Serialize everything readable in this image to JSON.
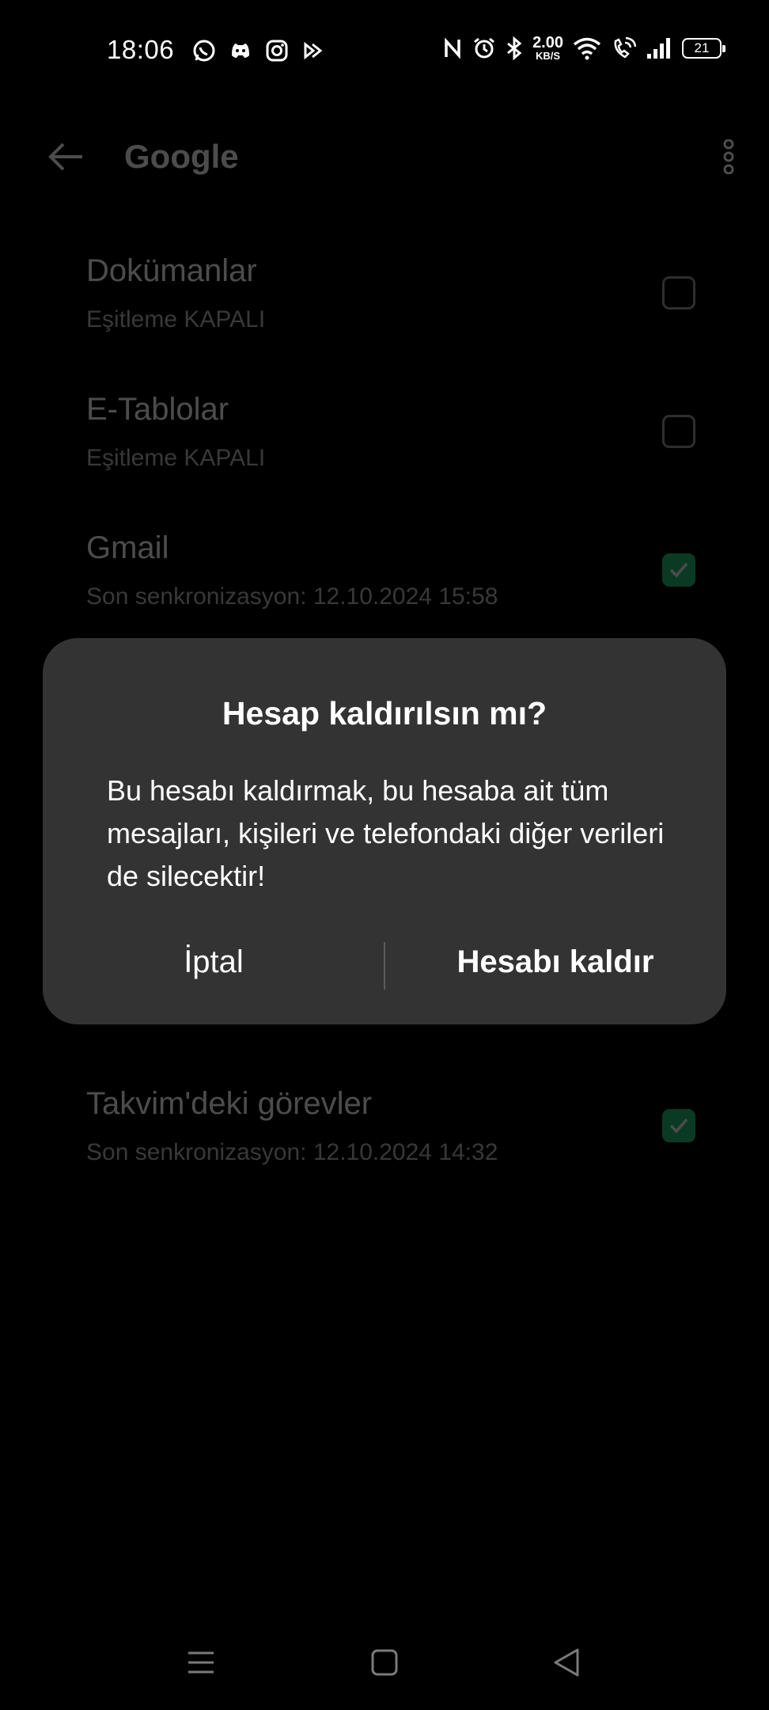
{
  "status_bar": {
    "time": "18:06",
    "net_speed_value": "2.00",
    "net_speed_unit": "KB/S",
    "battery_level": "21"
  },
  "app_bar": {
    "title": "Google"
  },
  "sync_items": [
    {
      "name": "Dokümanlar",
      "status": "Eşitleme KAPALI",
      "checked": false
    },
    {
      "name": "E-Tablolar",
      "status": "Eşitleme KAPALI",
      "checked": false
    },
    {
      "name": "Gmail",
      "status": "Son senkronizasyon: 12.10.2024 15:58",
      "checked": true
    },
    {
      "name": "Takvim'deki görevler",
      "status": "Son senkronizasyon: 12.10.2024 14:32",
      "checked": true
    }
  ],
  "dialog": {
    "title": "Hesap kaldırılsın mı?",
    "message": "Bu hesabı kaldırmak, bu hesaba ait tüm mesajları, kişileri ve telefondaki diğer verileri de silecektir!",
    "cancel_label": "İptal",
    "confirm_label": "Hesabı kaldır"
  },
  "colors": {
    "accent": "#27c47a",
    "dialog_bg": "#333333",
    "background": "#000000"
  }
}
